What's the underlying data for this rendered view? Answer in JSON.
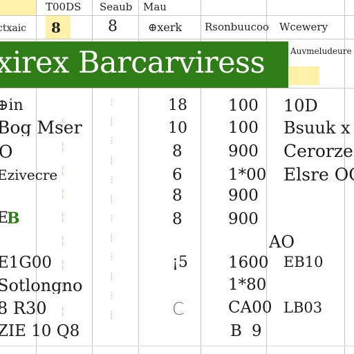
{
  "header": {
    "row1": [
      "T00DS",
      "Seaub",
      "Mau"
    ],
    "row2": {
      "a": "ctxaic",
      "b": "8",
      "c": "8",
      "d": "⊕xerk",
      "e": "Rsonbuucoo",
      "f": "Wcewery"
    }
  },
  "banner": {
    "text": "xirex Barcarviress"
  },
  "side_header": {
    "label1": "Auvmeludeure",
    "label2": ""
  },
  "rows": [
    {
      "a": "⊕in",
      "c": "18",
      "d": "100",
      "e": "10D"
    },
    {
      "a": "Bog Mser",
      "c": "10",
      "d": "100",
      "e": "Bsuuk x"
    },
    {
      "a": "O",
      "c": "8",
      "d": "900",
      "e": "Cerorze"
    },
    {
      "a": "Ezivecre",
      "c": "6",
      "d": "1*00",
      "e": "Elsre OC"
    },
    {
      "a": "B",
      "a_prefix": "E",
      "c": "8",
      "d": "900",
      "e": ""
    },
    {
      "a": "",
      "c": "",
      "d": "",
      "e": "AO"
    },
    {
      "a": "E1G00",
      "c": "¡5",
      "d": "1600",
      "e": "EB10"
    },
    {
      "a": "Sotlongno",
      "c": "",
      "d": "1*80",
      "e": ""
    },
    {
      "a": "8 R30",
      "c": "C",
      "d": "CA00",
      "e": "LB03"
    },
    {
      "a": "ZIE 10 Q8",
      "c": "",
      "d": "B",
      "e": "9"
    }
  ],
  "colors": {
    "banner_bg": "#2e7d16",
    "highlight_yellow": "#fff1a8",
    "grid": "#c9c9c9",
    "ghost_text": "#9ed39e"
  }
}
